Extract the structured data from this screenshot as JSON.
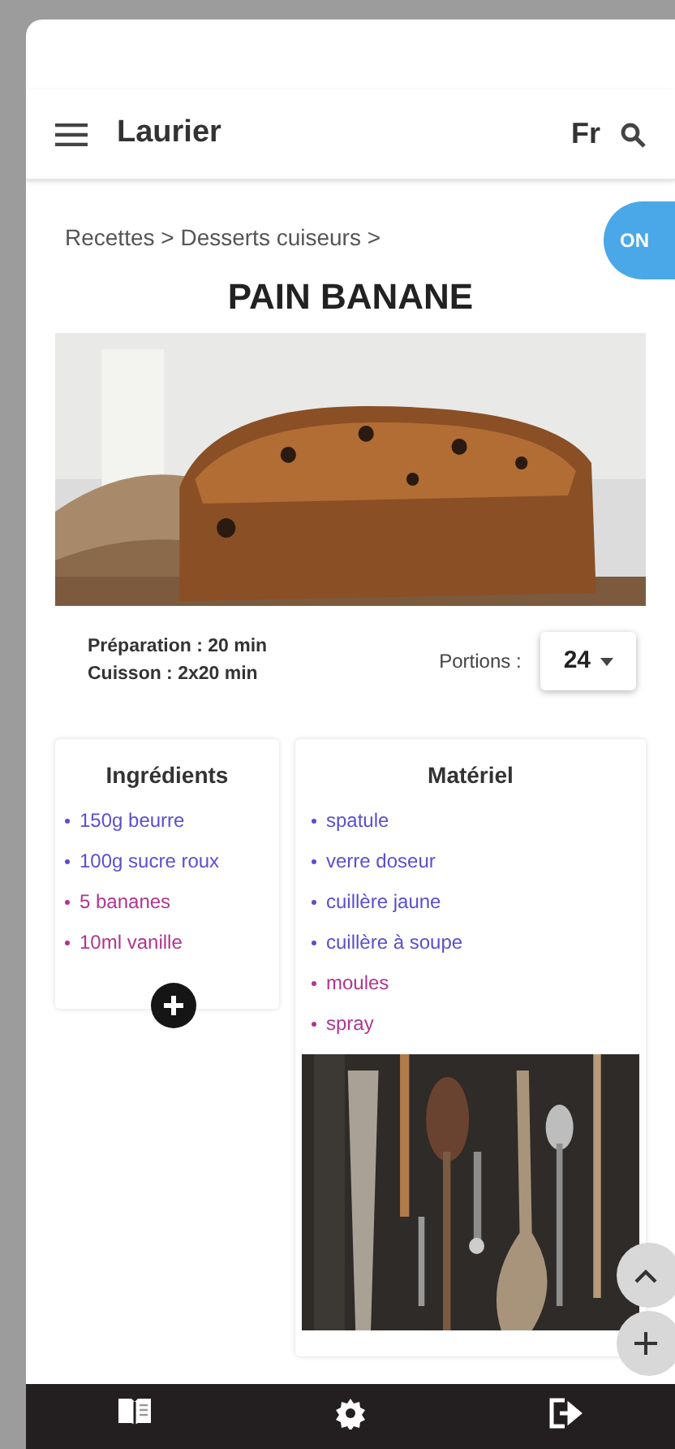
{
  "app_bar": {
    "title": "Laurier",
    "language": "Fr"
  },
  "breadcrumb": "Recettes > Desserts cuiseurs >",
  "toggle": {
    "label": "ON",
    "on": true
  },
  "recipe": {
    "title": "PAIN BANANE",
    "preparation": "Préparation : 20 min",
    "cuisson": "Cuisson : 2x20 min",
    "portions_label": "Portions :",
    "portions": "24"
  },
  "ingredients": {
    "title": "Ingrédients",
    "items": [
      {
        "text": "150g beurre",
        "color": "#5a4fcf"
      },
      {
        "text": "100g sucre roux",
        "color": "#5a4fcf"
      },
      {
        "text": "5 bananes",
        "color": "#b0358f"
      },
      {
        "text": "10ml vanille",
        "color": "#b0358f"
      }
    ]
  },
  "materiel": {
    "title": "Matériel",
    "items": [
      {
        "text": "spatule",
        "color": "#5a4fcf"
      },
      {
        "text": "verre doseur",
        "color": "#5a4fcf"
      },
      {
        "text": "cuillère jaune",
        "color": "#5a4fcf"
      },
      {
        "text": "cuillère à soupe",
        "color": "#5a4fcf"
      },
      {
        "text": "moules",
        "color": "#b0358f"
      },
      {
        "text": "spray",
        "color": "#b0358f"
      }
    ]
  }
}
